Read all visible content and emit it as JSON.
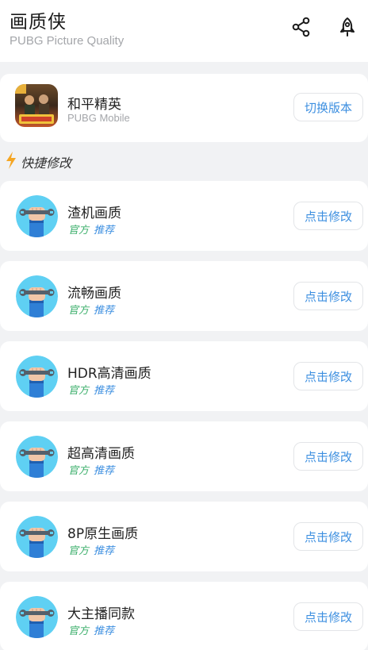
{
  "header": {
    "title": "画质侠",
    "subtitle": "PUBG Picture Quality",
    "icons": [
      "share-icon",
      "rocket-icon"
    ]
  },
  "game": {
    "name": "和平精英",
    "subtitle": "PUBG Mobile",
    "switch_label": "切换版本"
  },
  "section": {
    "title": "快捷修改",
    "icon": "lightning-icon"
  },
  "presets": [
    {
      "name": "渣机画质",
      "tag_official": "官方",
      "tag_recommend": "推荐",
      "button": "点击修改"
    },
    {
      "name": "流畅画质",
      "tag_official": "官方",
      "tag_recommend": "推荐",
      "button": "点击修改"
    },
    {
      "name": "HDR高清画质",
      "tag_official": "官方",
      "tag_recommend": "推荐",
      "button": "点击修改"
    },
    {
      "name": "超高清画质",
      "tag_official": "官方",
      "tag_recommend": "推荐",
      "button": "点击修改"
    },
    {
      "name": "8P原生画质",
      "tag_official": "官方",
      "tag_recommend": "推荐",
      "button": "点击修改"
    },
    {
      "name": "大主播同款",
      "tag_official": "官方",
      "tag_recommend": "推荐",
      "button": "点击修改"
    }
  ],
  "colors": {
    "accent": "#3d8fe0",
    "official_tag": "#3aae6a",
    "background": "#f1f2f4",
    "avatar_bg": "#5fd0f3"
  }
}
